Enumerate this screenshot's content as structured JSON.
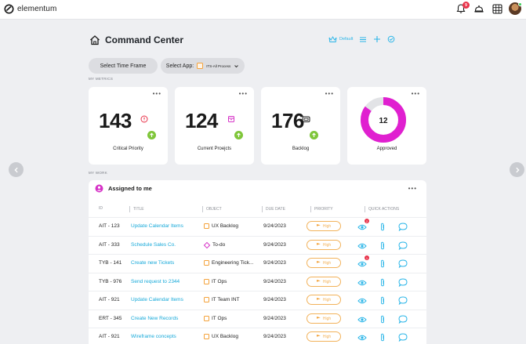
{
  "app": {
    "name": "elementum",
    "notification_count": "9"
  },
  "header": {
    "title": "Command Center",
    "default_label": "Default"
  },
  "filters": {
    "time_frame_label": "Select Time Frame",
    "app_label": "Select App:",
    "app_value": "ITS-All Process"
  },
  "sections": {
    "metrics_label": "MY METRICS",
    "work_label": "MY WORK"
  },
  "metrics": [
    {
      "value": "143",
      "label": "Critical Priority"
    },
    {
      "value": "124",
      "label": "Current Proejcts"
    },
    {
      "value": "176",
      "label": "Backlog"
    },
    {
      "value": "12",
      "label": "Approved",
      "fraction": 0.85
    }
  ],
  "work": {
    "title": "Assigned to me",
    "columns": [
      "ID",
      "TITLE",
      "OBJECT",
      "DUE DATE",
      "PRIORITY",
      "QUICK ACTIONS"
    ],
    "rows": [
      {
        "id": "AIT - 123",
        "title": "Update Calendar Items",
        "object": "UX Backlog",
        "object_type": "box",
        "due": "9/24/2023",
        "priority": "High",
        "badge": "2"
      },
      {
        "id": "AIT - 333",
        "title": "Schedule Sales Co.",
        "object": "To-do",
        "object_type": "diamond",
        "due": "9/24/2023",
        "priority": "High",
        "badge": ""
      },
      {
        "id": "TYB - 141",
        "title": "Create new Tickets",
        "object": "Engineering Tick...",
        "object_type": "box",
        "due": "9/24/2023",
        "priority": "High",
        "badge": "1"
      },
      {
        "id": "TYB - 976",
        "title": "Send request to 2344",
        "object": "IT Ops",
        "object_type": "box",
        "due": "9/24/2023",
        "priority": "High",
        "badge": ""
      },
      {
        "id": "AIT - 921",
        "title": "Update Calendar Items",
        "object": "IT Team INT",
        "object_type": "box",
        "due": "9/24/2023",
        "priority": "High",
        "badge": ""
      },
      {
        "id": "ERT - 345",
        "title": "Create New Records",
        "object": "IT Ops",
        "object_type": "box",
        "due": "9/24/2023",
        "priority": "High",
        "badge": ""
      },
      {
        "id": "AIT - 921",
        "title": "Wireframe concepts",
        "object": "UX Backlog",
        "object_type": "box",
        "due": "9/24/2023",
        "priority": "High",
        "badge": ""
      }
    ]
  },
  "colors": {
    "accent": "#29b5e8",
    "donut": "#e020d0",
    "priority": "#f2a23a",
    "up": "#7fc63a"
  }
}
